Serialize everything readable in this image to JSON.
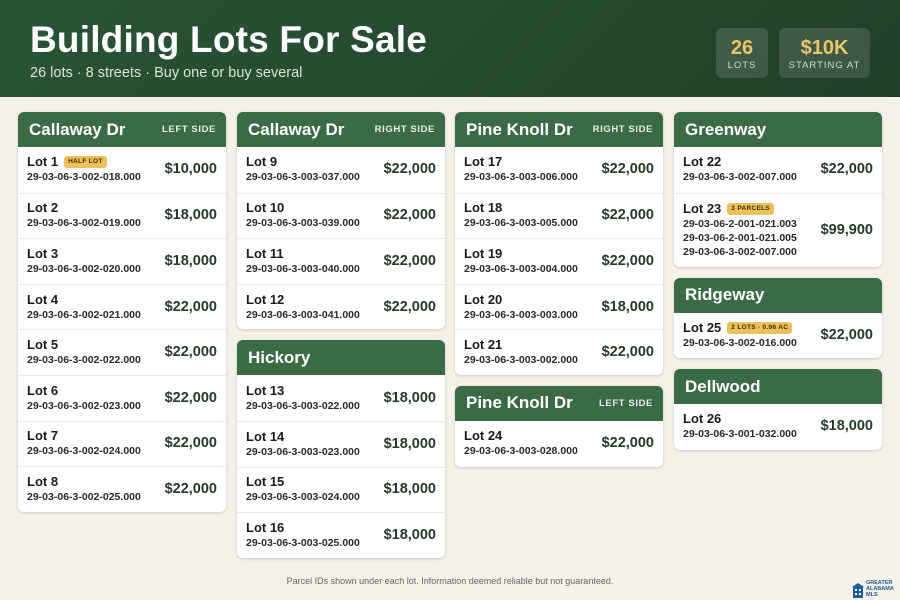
{
  "header": {
    "title": "Building Lots For Sale",
    "subtitle": "26 lots · 8 streets · Buy one or buy several",
    "stats": [
      {
        "value": "26",
        "label": "LOTS"
      },
      {
        "value": "$10K",
        "label": "STARTING AT"
      }
    ]
  },
  "cards": [
    {
      "name": "Callaway Dr",
      "side": "LEFT SIDE",
      "lots": [
        {
          "lot": "Lot 1",
          "badge": "HALF LOT",
          "parcels": [
            "29-03-06-3-002-018.000"
          ],
          "price": "$10,000"
        },
        {
          "lot": "Lot 2",
          "parcels": [
            "29-03-06-3-002-019.000"
          ],
          "price": "$18,000"
        },
        {
          "lot": "Lot 3",
          "parcels": [
            "29-03-06-3-002-020.000"
          ],
          "price": "$18,000"
        },
        {
          "lot": "Lot 4",
          "parcels": [
            "29-03-06-3-002-021.000"
          ],
          "price": "$22,000"
        },
        {
          "lot": "Lot 5",
          "parcels": [
            "29-03-06-3-002-022.000"
          ],
          "price": "$22,000"
        },
        {
          "lot": "Lot 6",
          "parcels": [
            "29-03-06-3-002-023.000"
          ],
          "price": "$22,000"
        },
        {
          "lot": "Lot 7",
          "parcels": [
            "29-03-06-3-002-024.000"
          ],
          "price": "$22,000"
        },
        {
          "lot": "Lot 8",
          "parcels": [
            "29-03-06-3-002-025.000"
          ],
          "price": "$22,000"
        }
      ]
    },
    {
      "name": "Callaway Dr",
      "side": "RIGHT SIDE",
      "lots": [
        {
          "lot": "Lot 9",
          "parcels": [
            "29-03-06-3-003-037.000"
          ],
          "price": "$22,000"
        },
        {
          "lot": "Lot 10",
          "parcels": [
            "29-03-06-3-003-039.000"
          ],
          "price": "$22,000"
        },
        {
          "lot": "Lot 11",
          "parcels": [
            "29-03-06-3-003-040.000"
          ],
          "price": "$22,000"
        },
        {
          "lot": "Lot 12",
          "parcels": [
            "29-03-06-3-003-041.000"
          ],
          "price": "$22,000"
        }
      ]
    },
    {
      "name": "Hickory",
      "side": "",
      "lots": [
        {
          "lot": "Lot 13",
          "parcels": [
            "29-03-06-3-003-022.000"
          ],
          "price": "$18,000"
        },
        {
          "lot": "Lot 14",
          "parcels": [
            "29-03-06-3-003-023.000"
          ],
          "price": "$18,000"
        },
        {
          "lot": "Lot 15",
          "parcels": [
            "29-03-06-3-003-024.000"
          ],
          "price": "$18,000"
        },
        {
          "lot": "Lot 16",
          "parcels": [
            "29-03-06-3-003-025.000"
          ],
          "price": "$18,000"
        }
      ]
    },
    {
      "name": "Pine Knoll Dr",
      "side": "RIGHT SIDE",
      "lots": [
        {
          "lot": "Lot 17",
          "parcels": [
            "29-03-06-3-003-006.000"
          ],
          "price": "$22,000"
        },
        {
          "lot": "Lot 18",
          "parcels": [
            "29-03-06-3-003-005.000"
          ],
          "price": "$22,000"
        },
        {
          "lot": "Lot 19",
          "parcels": [
            "29-03-06-3-003-004.000"
          ],
          "price": "$22,000"
        },
        {
          "lot": "Lot 20",
          "parcels": [
            "29-03-06-3-003-003.000"
          ],
          "price": "$18,000"
        },
        {
          "lot": "Lot 21",
          "parcels": [
            "29-03-06-3-003-002.000"
          ],
          "price": "$22,000"
        }
      ]
    },
    {
      "name": "Pine Knoll Dr",
      "side": "LEFT SIDE",
      "lots": [
        {
          "lot": "Lot 24",
          "parcels": [
            "29-03-06-3-003-028.000"
          ],
          "price": "$22,000"
        }
      ]
    },
    {
      "name": "Greenway",
      "side": "",
      "lots": [
        {
          "lot": "Lot 22",
          "parcels": [
            "29-03-06-3-002-007.000"
          ],
          "price": "$22,000"
        },
        {
          "lot": "Lot 23",
          "badge": "3 PARCELS",
          "parcels": [
            "29-03-06-2-001-021.003",
            "29-03-06-2-001-021.005",
            "29-03-06-3-002-007.000"
          ],
          "price": "$99,900"
        }
      ]
    },
    {
      "name": "Ridgeway",
      "side": "",
      "lots": [
        {
          "lot": "Lot 25",
          "badge": "2 LOTS · 0.96 AC",
          "parcels": [
            "29-03-06-3-002-016.000"
          ],
          "price": "$22,000"
        }
      ]
    },
    {
      "name": "Dellwood",
      "side": "",
      "lots": [
        {
          "lot": "Lot 26",
          "parcels": [
            "29-03-06-3-001-032.000"
          ],
          "price": "$18,000"
        }
      ]
    }
  ],
  "footer": {
    "note": "Parcel IDs shown under each lot. Information deemed reliable but not guaranteed.",
    "brand": "GREATER ALABAMA MLS"
  }
}
